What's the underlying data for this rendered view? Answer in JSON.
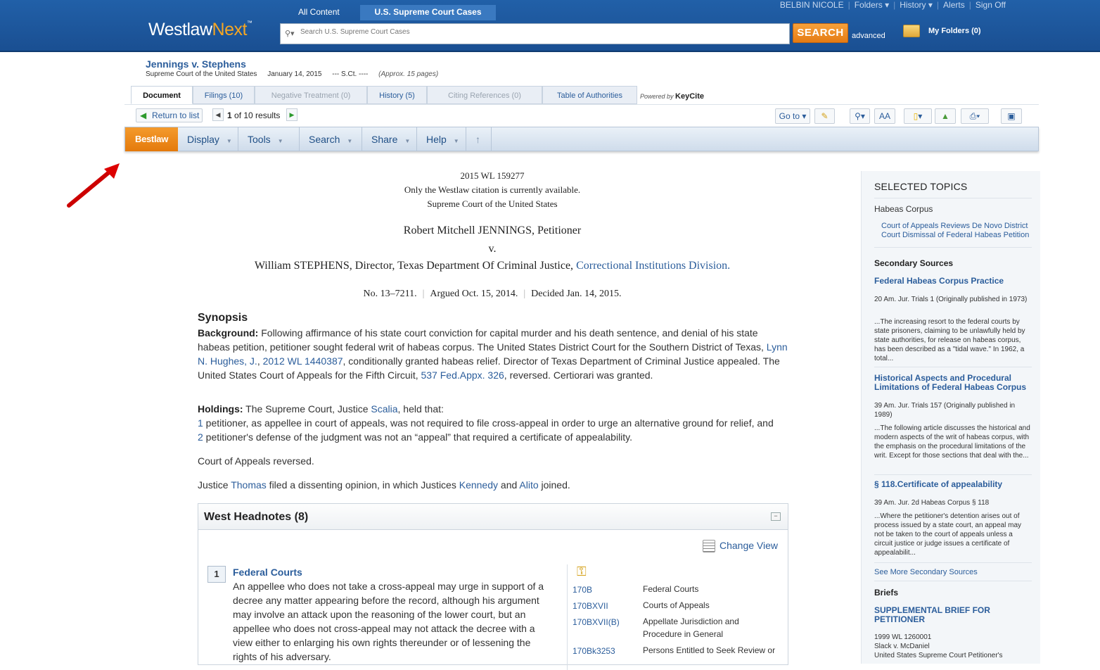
{
  "header": {
    "logo_main": "Westlaw",
    "logo_next": "Next",
    "logo_tm": "™",
    "scope_tabs": [
      "All Content",
      "U.S. Supreme Court Cases"
    ],
    "search_placeholder": "Search U.S. Supreme Court Cases",
    "search_button": "SEARCH",
    "advanced": "advanced",
    "my_folders": "My Folders (0)",
    "user_nav": {
      "user": "BELBIN NICOLE",
      "folders": "Folders ▾",
      "history": "History ▾",
      "alerts": "Alerts",
      "sign_off": "Sign Off"
    }
  },
  "document": {
    "title": "Jennings v. Stephens",
    "court": "Supreme Court of the United States",
    "date": "January 14, 2015",
    "cite": "--- S.Ct. ----",
    "pages": "(Approx. 15 pages)"
  },
  "doc_tabs": [
    {
      "label": "Document"
    },
    {
      "label": "Filings (10)"
    },
    {
      "label": "Negative Treatment (0)"
    },
    {
      "label": "History (5)"
    },
    {
      "label": "Citing References (0)"
    },
    {
      "label": "Table of Authorities"
    }
  ],
  "powered_by": "Powered by",
  "keycite": "KeyCite",
  "results_bar": {
    "return_to_list": "Return to list",
    "count_current": "1",
    "count_text": "of 10 results",
    "goto": "Go to ▾",
    "font_size": "AA"
  },
  "menu": {
    "bestlaw": "Bestlaw",
    "items": [
      "Display",
      "Tools",
      "Search",
      "Share",
      "Help"
    ],
    "up": "↑"
  },
  "body": {
    "citation": "2015 WL 159277",
    "availability": "Only the Westlaw citation is currently available.",
    "court_line": "Supreme Court of the United States",
    "petitioner": "Robert Mitchell JENNINGS, Petitioner",
    "versus": "v.",
    "respondent_prefix": "William STEPHENS, Director, Texas Department Of Criminal Justice, ",
    "respondent_link": "Correctional Institutions Division.",
    "docket": "No. 13–7211.",
    "argued": "Argued Oct. 15, 2014.",
    "decided": "Decided Jan. 14, 2015.",
    "synopsis_heading": "Synopsis",
    "background_label": "Background:",
    "background_1": " Following affirmance of his state court conviction for capital murder and his death sentence, and denial of his state habeas petition, petitioner sought federal writ of habeas corpus. The United States District Court for the Southern District of Texas, ",
    "background_link1": "Lynn N. Hughes, J.",
    "background_comma": ", ",
    "background_link2": "2012 WL 1440387",
    "background_2": ", conditionally granted habeas relief. Director of Texas Department of Criminal Justice appealed. The United States Court of Appeals for the Fifth Circuit, ",
    "background_link3": "537 Fed.Appx. 326",
    "background_3": ", reversed. Certiorari was granted.",
    "holdings_label": "Holdings:",
    "holdings_1": " The Supreme Court, Justice ",
    "holdings_link": "Scalia",
    "holdings_2": ", held that:",
    "holding1_num": "1",
    "holding1": " petitioner, as appellee in court of appeals, was not required to file cross-appeal in order to urge an alternative ground for relief, and",
    "holding2_num": "2",
    "holding2": " petitioner's defense of the judgment was not an “appeal” that required a certificate of appealability.",
    "court_reversed": "Court of Appeals reversed.",
    "dissent_1": "Justice ",
    "dissent_thomas": "Thomas",
    "dissent_2": " filed a dissenting opinion, in which Justices ",
    "dissent_kennedy": "Kennedy",
    "dissent_and": " and ",
    "dissent_alito": "Alito",
    "dissent_3": " joined."
  },
  "headnotes": {
    "title": "West Headnotes (8)",
    "change_view": "Change View",
    "number": "1",
    "topic": "Federal Courts",
    "text": "An appellee who does not take a cross-appeal may urge in support of a decree any matter appearing before the record, although his argument may involve an attack upon the reasoning of the lower court, but an appellee who does not cross-appeal may not attack the decree with a view either to enlarging his own rights thereunder or of lessening the rights of his adversary.",
    "key_numbers": [
      {
        "code": "170B",
        "desc": "Federal Courts"
      },
      {
        "code": "170BXVII",
        "desc": "Courts of Appeals"
      },
      {
        "code": "170BXVII(B)",
        "desc": "Appellate Jurisdiction and Procedure in General"
      },
      {
        "code": "170Bk3253",
        "desc": "Persons Entitled to Seek Review or"
      }
    ]
  },
  "right_rail": {
    "selected_topics": "SELECTED TOPICS",
    "topic": "Habeas Corpus",
    "topic_subs": [
      "Court of Appeals Reviews De Novo District",
      "Court Dismissal of Federal Habeas Petition"
    ],
    "secondary_heading": "Secondary Sources",
    "sources": [
      {
        "title": "Federal Habeas Corpus Practice",
        "cite": "20 Am. Jur. Trials 1 (Originally published in 1973)",
        "snippet": "...The increasing resort to the federal courts by state prisoners, claiming to be unlawfully held by state authorities, for release on habeas corpus, has been described as a \"tidal wave.\" In 1962, a total..."
      },
      {
        "title": "Historical Aspects and Procedural Limitations of Federal Habeas Corpus",
        "cite": "39 Am. Jur. Trials 157 (Originally published in 1989)",
        "snippet": "...The following article discusses the historical and modern aspects of the writ of habeas corpus, with the emphasis on the procedural limitations of the writ. Except for those sections that deal with the..."
      },
      {
        "title": "§ 118.Certificate of appealability",
        "cite": "39 Am. Jur. 2d Habeas Corpus § 118",
        "snippet": "...Where the petitioner's detention arises out of process issued by a state court, an appeal may not be taken to the court of appeals unless a circuit justice or judge issues a certificate of appealabilit..."
      }
    ],
    "see_more": "See More Secondary Sources",
    "briefs_heading": "Briefs",
    "brief_title": "SUPPLEMENTAL BRIEF FOR PETITIONER",
    "brief_lines": [
      "1999 WL 1260001",
      "Slack v. McDaniel",
      "United States Supreme Court Petitioner's"
    ]
  }
}
